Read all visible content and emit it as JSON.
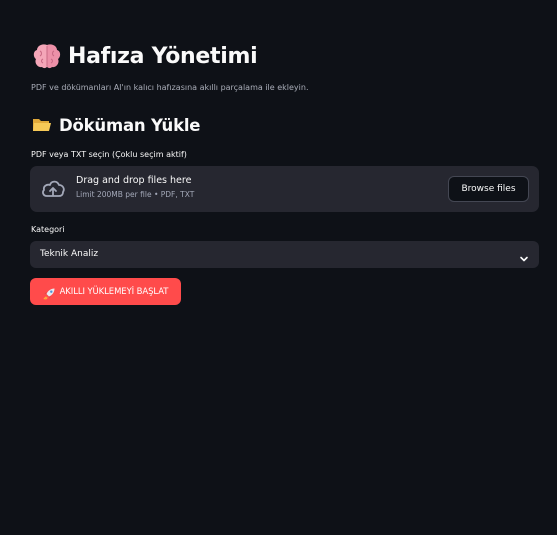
{
  "header": {
    "title": "Hafıza Yönetimi",
    "title_icon": "brain-icon",
    "subtitle": "PDF ve dökümanları AI'ın kalıcı hafızasına akıllı parçalama ile ekleyin."
  },
  "upload_section": {
    "title": "Döküman Yükle",
    "title_icon": "folder-icon",
    "field_label": "PDF veya TXT seçin (Çoklu seçim aktif)",
    "dropzone": {
      "icon": "cloud-upload-icon",
      "primary_text": "Drag and drop files here",
      "secondary_text": "Limit 200MB per file • PDF, TXT",
      "browse_label": "Browse files"
    }
  },
  "category": {
    "label": "Kategori",
    "selected": "Teknik Analiz",
    "icon": "chevron-down-icon"
  },
  "actions": {
    "start_label": "AKILLI YÜKLEMEYİ BAŞLAT",
    "start_icon": "rocket-icon"
  },
  "colors": {
    "background": "#0e1117",
    "surface": "#262730",
    "primary": "#ff4b4b",
    "text": "#fafafa",
    "muted_text": "#a3a8b8"
  }
}
